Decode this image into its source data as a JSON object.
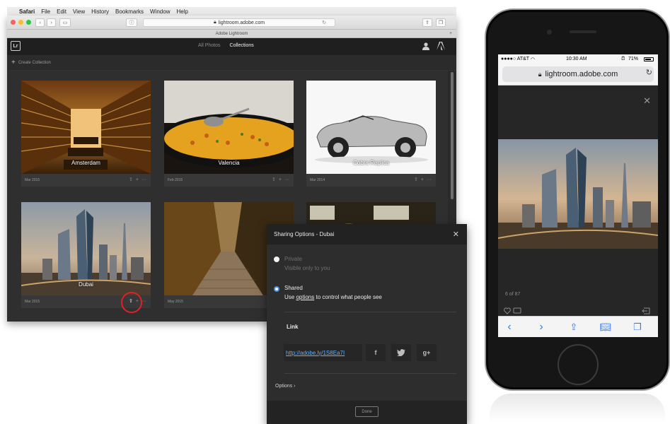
{
  "menubar": {
    "items": [
      "Safari",
      "File",
      "Edit",
      "View",
      "History",
      "Bookmarks",
      "Window",
      "Help"
    ]
  },
  "browser": {
    "address": "lightroom.adobe.com",
    "tab_title": "Adobe Lightroom"
  },
  "lightroom": {
    "logo": "Lr",
    "nav": {
      "all_photos": "All Photos",
      "collections": "Collections"
    },
    "create_collection": "Create Collection",
    "collections": [
      {
        "name": "Amsterdam",
        "date": "Mar 2015"
      },
      {
        "name": "Valencia",
        "date": "Feb 2015"
      },
      {
        "name": "Cobra Replica",
        "date": "Mar 2014"
      },
      {
        "name": "Dubai",
        "date": "Mar 2015"
      },
      {
        "name": "",
        "date": "May 2015"
      }
    ]
  },
  "share_dialog": {
    "title": "Sharing Options - Dubai",
    "private_label": "Private",
    "private_desc": "Visible only to you",
    "shared_label": "Shared",
    "shared_desc_prefix": "Use ",
    "shared_desc_link": "options",
    "shared_desc_suffix": " to control what people see",
    "link_heading": "Link",
    "link_url": "http://adobe.ly/1S8Ea7I",
    "social": [
      "f",
      "t",
      "g+"
    ],
    "options_label": "Options ›",
    "done_label": "Done",
    "accent_color": "#4a90e2"
  },
  "phone": {
    "carrier": "●●●●○ AT&T",
    "time": "10:30 AM",
    "battery": "71%",
    "url": "lightroom.adobe.com",
    "counter": "6 of 87"
  }
}
